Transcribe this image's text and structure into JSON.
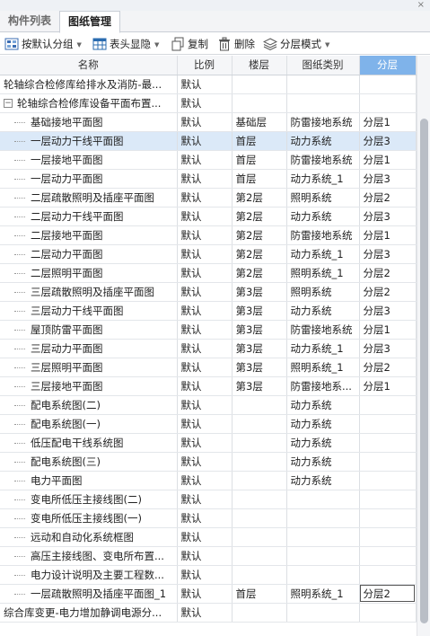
{
  "window": {
    "pin": "×"
  },
  "tabs": [
    {
      "label": "构件列表",
      "active": false
    },
    {
      "label": "图纸管理",
      "active": true
    }
  ],
  "toolbar": {
    "group_label": "按默认分组",
    "header_label": "表头显隐",
    "copy_label": "复制",
    "delete_label": "删除",
    "layer_mode_label": "分层模式",
    "icons": [
      "group-icon",
      "table-header-icon",
      "copy-icon",
      "delete-icon",
      "layer-mode-icon"
    ]
  },
  "table": {
    "columns": [
      "名称",
      "比例",
      "楼层",
      "图纸类别",
      "分层"
    ],
    "highlight_column": "分层",
    "rows": [
      {
        "name": "轮轴综合检修库给排水及消防-最...",
        "scale": "默认",
        "floor": "",
        "category": "",
        "layer": "",
        "indent": 0,
        "expander": ""
      },
      {
        "name": "轮轴综合检修库设备平面布置...",
        "scale": "默认",
        "floor": "",
        "category": "",
        "layer": "",
        "indent": 0,
        "expander": "−"
      },
      {
        "name": "基础接地平面图",
        "scale": "默认",
        "floor": "基础层",
        "category": "防雷接地系统",
        "layer": "分层1",
        "indent": 1
      },
      {
        "name": "一层动力干线平面图",
        "scale": "默认",
        "floor": "首层",
        "category": "动力系统",
        "layer": "分层3",
        "indent": 1,
        "selected": true
      },
      {
        "name": "一层接地平面图",
        "scale": "默认",
        "floor": "首层",
        "category": "防雷接地系统",
        "layer": "分层1",
        "indent": 1
      },
      {
        "name": "一层动力平面图",
        "scale": "默认",
        "floor": "首层",
        "category": "动力系统_1",
        "layer": "分层3",
        "indent": 1
      },
      {
        "name": "二层疏散照明及插座平面图",
        "scale": "默认",
        "floor": "第2层",
        "category": "照明系统",
        "layer": "分层2",
        "indent": 1
      },
      {
        "name": "二层动力干线平面图",
        "scale": "默认",
        "floor": "第2层",
        "category": "动力系统",
        "layer": "分层3",
        "indent": 1
      },
      {
        "name": "二层接地平面图",
        "scale": "默认",
        "floor": "第2层",
        "category": "防雷接地系统",
        "layer": "分层1",
        "indent": 1
      },
      {
        "name": "二层动力平面图",
        "scale": "默认",
        "floor": "第2层",
        "category": "动力系统_1",
        "layer": "分层3",
        "indent": 1
      },
      {
        "name": "二层照明平面图",
        "scale": "默认",
        "floor": "第2层",
        "category": "照明系统_1",
        "layer": "分层2",
        "indent": 1
      },
      {
        "name": "三层疏散照明及插座平面图",
        "scale": "默认",
        "floor": "第3层",
        "category": "照明系统",
        "layer": "分层2",
        "indent": 1
      },
      {
        "name": "三层动力干线平面图",
        "scale": "默认",
        "floor": "第3层",
        "category": "动力系统",
        "layer": "分层3",
        "indent": 1
      },
      {
        "name": "屋顶防雷平面图",
        "scale": "默认",
        "floor": "第3层",
        "category": "防雷接地系统",
        "layer": "分层1",
        "indent": 1
      },
      {
        "name": "三层动力平面图",
        "scale": "默认",
        "floor": "第3层",
        "category": "动力系统_1",
        "layer": "分层3",
        "indent": 1
      },
      {
        "name": "三层照明平面图",
        "scale": "默认",
        "floor": "第3层",
        "category": "照明系统_1",
        "layer": "分层2",
        "indent": 1
      },
      {
        "name": "三层接地平面图",
        "scale": "默认",
        "floor": "第3层",
        "category": "防雷接地系...",
        "layer": "分层1",
        "indent": 1
      },
      {
        "name": "配电系统图(二)",
        "scale": "默认",
        "floor": "",
        "category": "动力系统",
        "layer": "",
        "indent": 1
      },
      {
        "name": "配电系统图(一)",
        "scale": "默认",
        "floor": "",
        "category": "动力系统",
        "layer": "",
        "indent": 1
      },
      {
        "name": "低压配电干线系统图",
        "scale": "默认",
        "floor": "",
        "category": "动力系统",
        "layer": "",
        "indent": 1
      },
      {
        "name": "配电系统图(三)",
        "scale": "默认",
        "floor": "",
        "category": "动力系统",
        "layer": "",
        "indent": 1
      },
      {
        "name": "电力平面图",
        "scale": "默认",
        "floor": "",
        "category": "动力系统",
        "layer": "",
        "indent": 1
      },
      {
        "name": "变电所低压主接线图(二)",
        "scale": "默认",
        "floor": "",
        "category": "",
        "layer": "",
        "indent": 1
      },
      {
        "name": "变电所低压主接线图(一)",
        "scale": "默认",
        "floor": "",
        "category": "",
        "layer": "",
        "indent": 1
      },
      {
        "name": "远动和自动化系统框图",
        "scale": "默认",
        "floor": "",
        "category": "",
        "layer": "",
        "indent": 1
      },
      {
        "name": "高压主接线图、变电所布置...",
        "scale": "默认",
        "floor": "",
        "category": "",
        "layer": "",
        "indent": 1
      },
      {
        "name": "电力设计说明及主要工程数...",
        "scale": "默认",
        "floor": "",
        "category": "",
        "layer": "",
        "indent": 1
      },
      {
        "name": "一层疏散照明及插座平面图_1",
        "scale": "默认",
        "floor": "首层",
        "category": "照明系统_1",
        "layer": "分层2",
        "indent": 1,
        "layer_boxed": true
      },
      {
        "name": "综合库变更-电力增加静调电源分...",
        "scale": "默认",
        "floor": "",
        "category": "",
        "layer": "",
        "indent": 0,
        "expander": ""
      }
    ]
  },
  "colors": {
    "header_highlight": "#7fb3ea",
    "selected_row": "#dbe9f8",
    "scrollbar_thumb": "#b9bec6"
  }
}
